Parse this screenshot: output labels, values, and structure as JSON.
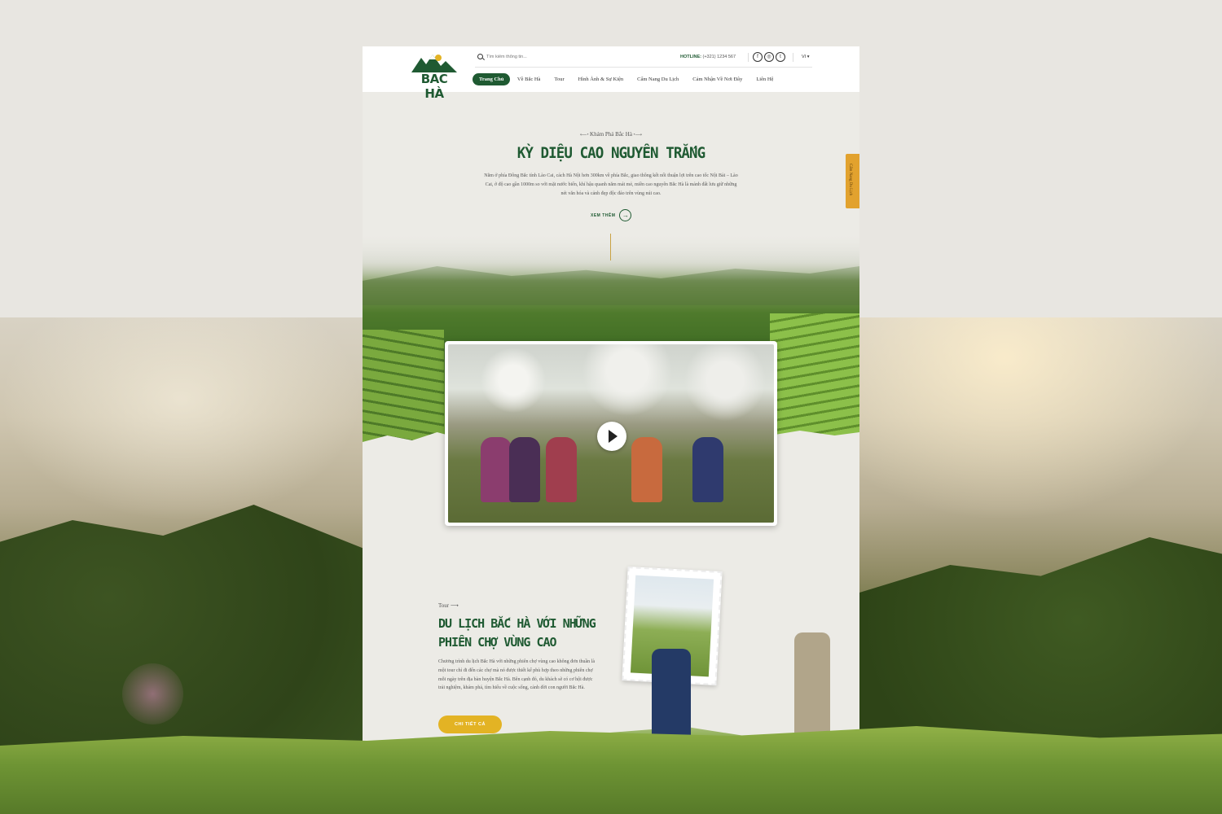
{
  "header": {
    "logo_text": "BAC HÀ",
    "search_placeholder": "Tìm kiếm thông tin...",
    "hotline_label": "HOTLINE:",
    "hotline_number": "(+321) 1234 567",
    "socials": [
      "f",
      "◎",
      "t"
    ],
    "language": "VI",
    "nav": [
      {
        "label": "Trang Chủ",
        "active": true
      },
      {
        "label": "Về Bắc Hà"
      },
      {
        "label": "Tour"
      },
      {
        "label": "Hình Ảnh & Sự Kiện"
      },
      {
        "label": "Cẩm Nang Du Lịch"
      },
      {
        "label": "Cảm Nhận Về Nơi Đây"
      },
      {
        "label": "Liên Hệ"
      }
    ]
  },
  "hero": {
    "kicker": "Khám Phá Bắc Hà",
    "title": "KỲ DIỆU CAO NGUYÊN TRẮNG",
    "description": "Nằm ở phía Đông Bắc tỉnh Lào Cai, cách Hà Nội hơn 300km về phía Bắc, giao thông kết nối thuận lợi trên cao tốc Nội Bài – Lào Cai, ở độ cao gần 1000m so với mặt nước biển, khí hậu quanh năm mát mẻ, miền cao nguyên Bắc Hà là mảnh đất lưu giữ những nét văn hóa và cảnh đẹp độc đáo trên vùng núi cao.",
    "more_label": "XEM THÊM"
  },
  "side_tab": {
    "label": "Cẩm Nang Du Lịch"
  },
  "tour": {
    "kicker": "Tour",
    "title": "DU LỊCH BẮC HÀ VỚI NHỮNG PHIÊN CHỢ VÙNG CAO",
    "description": "Chương trình du lịch Bắc Hà với những phiên chợ vùng cao không đơn thuần là một tour chỉ đi đến các chợ mà nó được thiết kế phù hợp theo những phiên chợ mỗi ngày trên địa bàn huyện Bắc Hà. Bên cạnh đó, du khách sẽ có cơ hội được trải nghiệm, khám phá, tìm hiểu về cuộc sống, cảnh đời con người Bắc Hà.",
    "button_label": "CHI TIẾT CÁ"
  },
  "colors": {
    "brand_green": "#1f5a32",
    "accent_gold": "#e3b324",
    "side_tab": "#e2a22e"
  }
}
